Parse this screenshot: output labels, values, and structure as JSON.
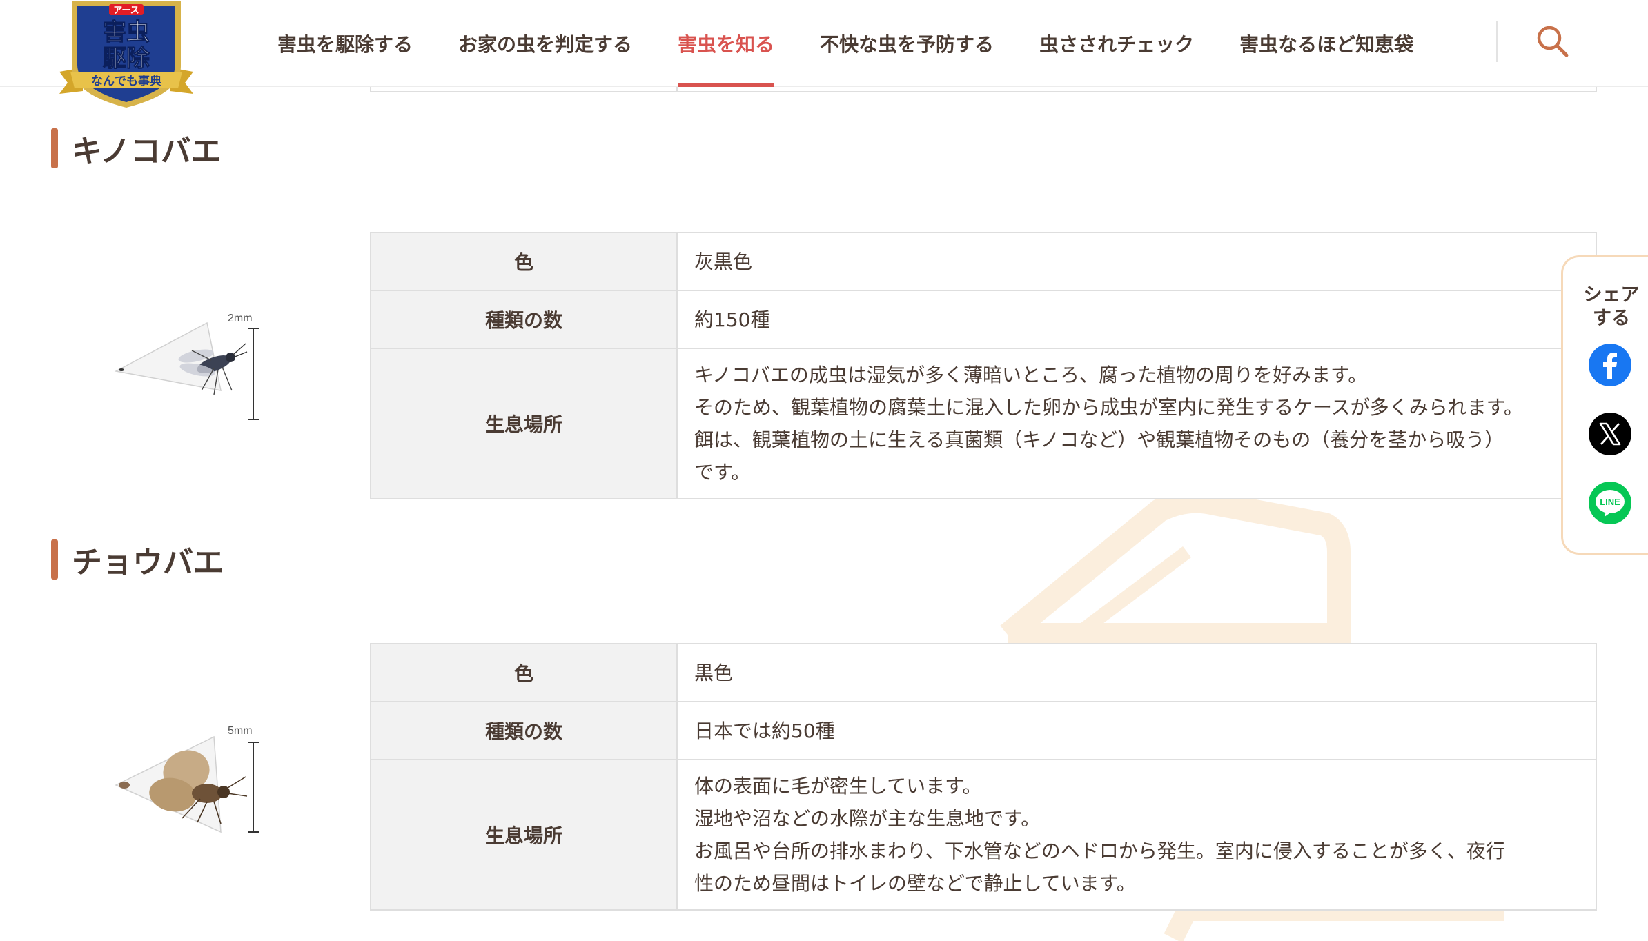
{
  "header": {
    "logo_alt": "アース 害虫駆除 なんでも事典",
    "logo_lines": [
      "アース",
      "害虫",
      "駆除",
      "なんでも事典"
    ],
    "nav": [
      {
        "label": "害虫を駆除する",
        "active": false
      },
      {
        "label": "お家の虫を判定する",
        "active": false
      },
      {
        "label": "害虫を知る",
        "active": true
      },
      {
        "label": "不快な虫を予防する",
        "active": false
      },
      {
        "label": "虫さされチェック",
        "active": false
      },
      {
        "label": "害虫なるほど知恵袋",
        "active": false
      }
    ],
    "search_icon": "search-icon",
    "accent_color": "#d9534f"
  },
  "sections": [
    {
      "title": "キノコバエ",
      "size_label": "2mm",
      "rows": [
        {
          "label": "色",
          "value": "灰黒色"
        },
        {
          "label": "種類の数",
          "value": "約150種"
        },
        {
          "label": "生息場所",
          "lines": [
            "キノコバエの成虫は湿気が多く薄暗いところ、腐った植物の周りを好みます。",
            "そのため、観葉植物の腐葉土に混入した卵から成虫が室内に発生するケースが多くみられます。",
            "餌は、観葉植物の土に生える真菌類（キノコなど）や観葉植物そのもの（養分を茎から吸う）",
            "です。"
          ]
        }
      ]
    },
    {
      "title": "チョウバエ",
      "size_label": "5mm",
      "rows": [
        {
          "label": "色",
          "value": "黒色"
        },
        {
          "label": "種類の数",
          "value": "日本では約50種"
        },
        {
          "label": "生息場所",
          "lines": [
            "体の表面に毛が密生しています。",
            "湿地や沼などの水際が主な生息地です。",
            "お風呂や台所の排水まわり、下水管などのヘドロから発生。室内に侵入することが多く、夜行",
            "性のため昼間はトイレの壁などで静止しています。"
          ]
        }
      ]
    }
  ],
  "share": {
    "label_lines": [
      "シェア",
      "する"
    ],
    "buttons": [
      {
        "icon": "facebook-icon",
        "color": "#1877f2"
      },
      {
        "icon": "x-icon",
        "color": "#000000"
      },
      {
        "icon": "line-icon",
        "color": "#06c755",
        "text": "LINE"
      }
    ]
  },
  "colors": {
    "heading_bar": "#c8714a",
    "text": "#4a3b33",
    "table_header_bg": "#f2f2f2",
    "share_border": "#f6d9b9"
  }
}
